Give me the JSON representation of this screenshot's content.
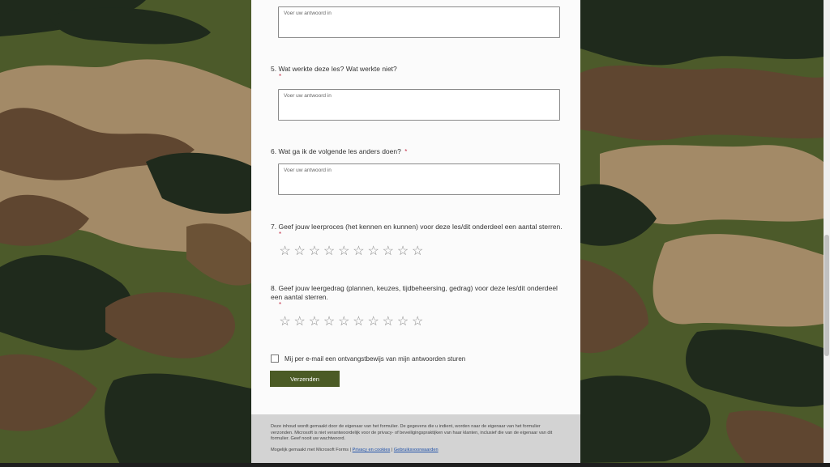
{
  "form": {
    "placeholder": "Voer uw antwoord in",
    "q5": {
      "num": "5.",
      "title": "Wat werkte deze les? Wat werkte niet?"
    },
    "q6": {
      "num": "6.",
      "title": "Wat ga ik de volgende les anders doen?"
    },
    "q7": {
      "num": "7.",
      "title": "Geef jouw leerproces (het kennen en kunnen) voor deze les/dit onderdeel een aantal sterren.",
      "rating_scale": 10
    },
    "q8": {
      "num": "8.",
      "title": "Geef jouw leergedrag (plannen, keuzes, tijdbeheersing, gedrag) voor deze les/dit onderdeel een aantal sterren.",
      "rating_scale": 10
    },
    "required_mark": "*",
    "receipt_label": "Mij per e-mail een ontvangstbewijs van mijn antwoorden sturen",
    "submit_label": "Verzenden"
  },
  "footer": {
    "disclaimer": "Deze inhoud wordt gemaakt door de eigenaar van het formulier. De gegevens die u indient, worden naar de eigenaar van het formulier verzonden. Microsoft is niet verantwoordelijk voor de privacy- of beveiligingspraktijken van haar klanten, inclusief die van de eigenaar van dit formulier. Geef nooit uw wachtwoord.",
    "powered": "Mogelijk gemaakt met Microsoft Forms",
    "sep": "|",
    "privacy_link": "Privacy en cookies",
    "terms_link": "Gebruiksvoorwaarden"
  },
  "colors": {
    "accent": "#4b5b25",
    "required": "#c4314b",
    "link": "#1d4fa8"
  }
}
